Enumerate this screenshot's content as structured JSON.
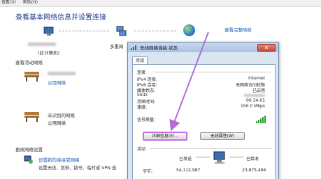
{
  "menu": {
    "items": [
      "查看(V)",
      "帮助(H)"
    ]
  },
  "header": {
    "title": "查看基本网络信息并设置连接",
    "full_map_link": "查看完整映射"
  },
  "map": {
    "computer_label": "(此计算机)",
    "network_label": "多重网"
  },
  "active_networks": {
    "heading": "查看活动网络",
    "items": [
      {
        "type": "公用网络"
      },
      {
        "name": "未识别的网络",
        "type": "公用网络"
      }
    ]
  },
  "change_settings": {
    "heading": "更改网络设置",
    "items": [
      {
        "link": "设置新的连接或网络",
        "desc": "设置无线、宽带、拨号、临时或 VPN 连"
      }
    ]
  },
  "dialog": {
    "title": "无线网络连接 状态",
    "close": "✕",
    "tab": "常规",
    "connection_heading": "连接",
    "rows": [
      {
        "label": "IPv4 连接:",
        "value": "Internet"
      },
      {
        "label": "IPv6 连接:",
        "value": "无网络访问权限"
      },
      {
        "label": "媒体状态:",
        "value": "已启用"
      },
      {
        "label": "SSID:",
        "value": ""
      },
      {
        "label": "持续时间:",
        "value": "00:34:01"
      },
      {
        "label": "速度:",
        "value": "150.0 Mbps"
      }
    ],
    "signal_label": "信号质量:",
    "details_button": "详细信息(E)...",
    "wireless_props_button": "无线属性(W)",
    "activity_heading": "活动",
    "sent_label": "已发送",
    "received_label": "已接收",
    "bytes_label": "字节:",
    "sent_bytes": "54,112,987",
    "received_bytes": "23,875,494"
  },
  "colors": {
    "accent": "#1a5fb4",
    "highlight": "#c070e0",
    "arrow": "#b56ad9"
  }
}
